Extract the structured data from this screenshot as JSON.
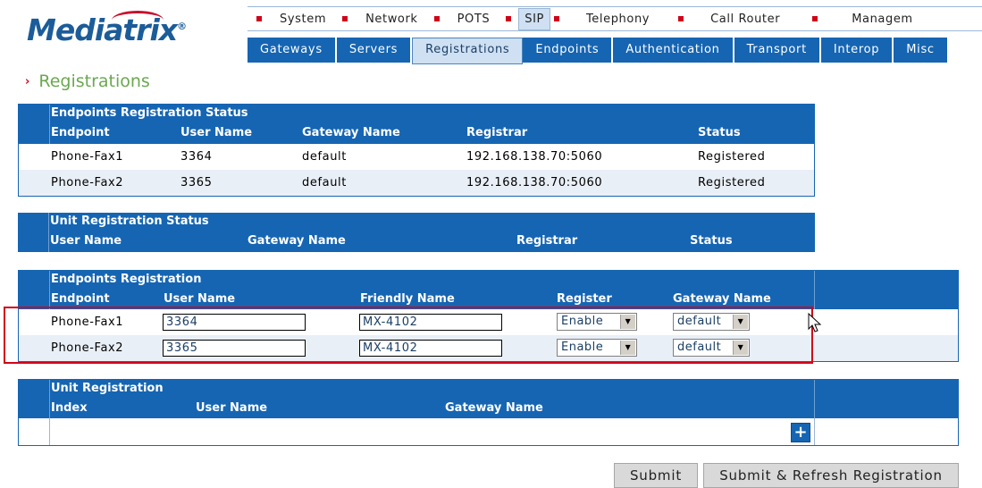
{
  "brand": {
    "logo": "Mediatrix",
    "registered": "®"
  },
  "topnav": [
    "System",
    "Network",
    "POTS",
    "SIP",
    "Telephony",
    "Call Router",
    "Managem"
  ],
  "topnav_active": "SIP",
  "subnav": [
    "Gateways",
    "Servers",
    "Registrations",
    "Endpoints",
    "Authentication",
    "Transport",
    "Interop",
    "Misc"
  ],
  "subnav_active": "Registrations",
  "page_title": "Registrations",
  "endpoints_status": {
    "caption": "Endpoints Registration Status",
    "columns": [
      "Endpoint",
      "User Name",
      "Gateway Name",
      "Registrar",
      "Status"
    ],
    "rows": [
      [
        "Phone-Fax1",
        "3364",
        "default",
        "192.168.138.70:5060",
        "Registered"
      ],
      [
        "Phone-Fax2",
        "3365",
        "default",
        "192.168.138.70:5060",
        "Registered"
      ]
    ]
  },
  "unit_status": {
    "caption": "Unit Registration Status",
    "columns": [
      "User Name",
      "Gateway Name",
      "Registrar",
      "Status"
    ]
  },
  "endpoints_registration": {
    "caption": "Endpoints Registration",
    "columns": [
      "Endpoint",
      "User Name",
      "Friendly Name",
      "Register",
      "Gateway Name"
    ],
    "rows": [
      {
        "endpoint": "Phone-Fax1",
        "user": "3364",
        "friendly": "MX-4102",
        "register": "Enable",
        "gateway": "default"
      },
      {
        "endpoint": "Phone-Fax2",
        "user": "3365",
        "friendly": "MX-4102",
        "register": "Enable",
        "gateway": "default"
      }
    ]
  },
  "unit_registration": {
    "caption": "Unit Registration",
    "columns": [
      "Index",
      "User Name",
      "Gateway Name"
    ],
    "add_icon": "+"
  },
  "buttons": {
    "submit": "Submit",
    "submit_refresh": "Submit & Refresh Registration"
  },
  "colors": {
    "header_blue": "#1565b3",
    "accent_red": "#d0021b",
    "title_green": "#6aa84f"
  }
}
